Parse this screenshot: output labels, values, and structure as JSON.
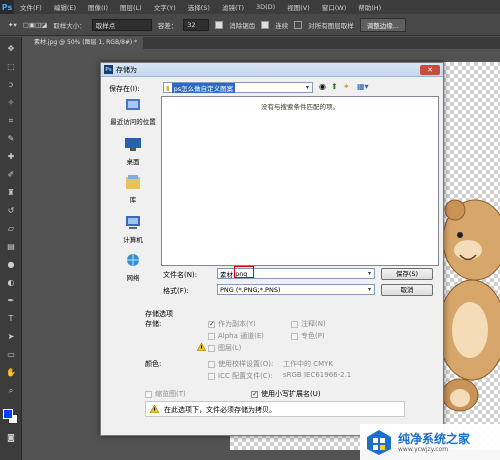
{
  "app": {
    "logo": "Ps",
    "menu": [
      "文件(F)",
      "编辑(E)",
      "图像(I)",
      "图层(L)",
      "文字(Y)",
      "选择(S)",
      "滤镜(T)",
      "3D(D)",
      "视图(V)",
      "窗口(W)",
      "帮助(H)"
    ]
  },
  "options_bar": {
    "sample_size_label": "取样大小：",
    "sample_size_value": "取样点",
    "tolerance_label": "容差：",
    "tolerance_value": "32",
    "antialias_label": "消除锯齿",
    "contiguous_label": "连续",
    "all_layers_label": "对所有图层取样",
    "refine_edge_label": "调整边缘..."
  },
  "document": {
    "tab_label": "素材.jpg @ 50% (图层 1, RGB/8#) *"
  },
  "dialog": {
    "title": "存储为",
    "save_in_label": "保存在(I):",
    "save_in_value": "ps怎么做自定义图案",
    "empty_message": "没有与搜索条件匹配的项。",
    "places": [
      "最近访问的位置",
      "桌面",
      "库",
      "计算机",
      "网络"
    ],
    "filename_label": "文件名(N):",
    "filename_base": "素材",
    "filename_ext": ".png",
    "format_label": "格式(F):",
    "format_value": "PNG (*.PNG;*.PNS)",
    "save_button": "保存(S)",
    "cancel_button": "取消",
    "save_options_title": "存储选项",
    "save_label": "存储:",
    "as_copy": "作为副本(Y)",
    "alpha_channels": "Alpha 通道(E)",
    "layers": "图层(L)",
    "notes": "注释(N)",
    "spot_colors": "专色(P)",
    "color_label": "颜色:",
    "use_proof_setup": "使用校样设置(O):",
    "proof_value": "工作中的 CMYK",
    "icc_profile": "ICC 配置文件(C):",
    "icc_value": "sRGB IEC61966-2.1",
    "thumbnail": "缩览图(T)",
    "lowercase_ext": "使用小写扩展名(U)",
    "warning_message": "在此选项下，文件必须存储为拷贝。"
  },
  "watermark": {
    "title": "纯净系统之家",
    "url": "www.ycwjzy.com"
  }
}
